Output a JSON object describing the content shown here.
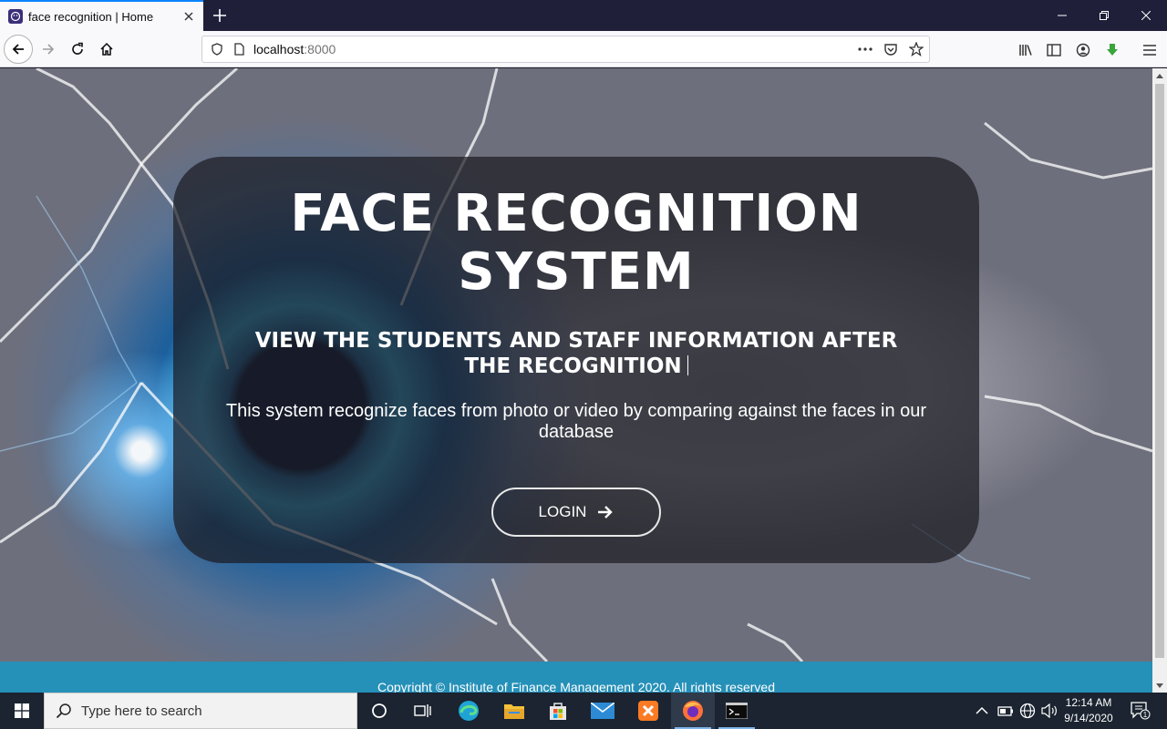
{
  "browser": {
    "tab_title": "face recognition | Home",
    "url_host": "localhost",
    "url_port": ":8000"
  },
  "hero": {
    "title_line1": "FACE RECOGNITION",
    "title_line2": "SYSTEM",
    "subtitle": "VIEW THE STUDENTS AND STAFF INFORMATION AFTER THE RECOGNITION",
    "description": "This system recognize faces from photo or video by comparing against the faces in our database",
    "login_label": "LOGIN"
  },
  "footer": {
    "copyright": "Copyright © Institute of Finance Management 2020. All rights reserved"
  },
  "taskbar": {
    "search_placeholder": "Type here to search",
    "time": "12:14 AM",
    "date": "9/14/2020",
    "notification_count": "1"
  },
  "colors": {
    "footer_bg": "#2590b8",
    "panel_bg": "rgba(28,28,34,0.72)",
    "tab_accent": "#0a84ff"
  }
}
